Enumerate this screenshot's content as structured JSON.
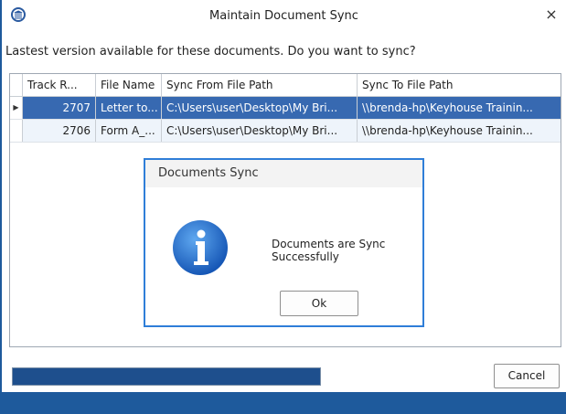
{
  "window": {
    "title": "Maintain Document Sync",
    "close_glyph": "×",
    "app_icon": "institution-icon"
  },
  "prompt": "Lastest version available for these documents. Do you want to sync?",
  "grid": {
    "columns": [
      "Track R...",
      "File Name",
      "Sync From File Path",
      "Sync To File Path"
    ],
    "rows": [
      {
        "indicator": "▶",
        "track": "2707",
        "file": "Letter to...",
        "from": "C:\\Users\\user\\Desktop\\My Bri...",
        "to": "\\\\brenda-hp\\Keyhouse Trainin..."
      },
      {
        "indicator": "",
        "track": "2706",
        "file": "Form A_...",
        "from": "C:\\Users\\user\\Desktop\\My Bri...",
        "to": "\\\\brenda-hp\\Keyhouse Trainin..."
      }
    ]
  },
  "modal": {
    "title": "Documents Sync",
    "message": "Documents are Sync Successfully",
    "ok_label": "Ok",
    "icon": "info-icon"
  },
  "progress": {
    "value": 1.0
  },
  "cancel_label": "Cancel",
  "colors": {
    "accent": "#2f7ed8",
    "selection": "#3769b1",
    "progress_fill": "#1e4f8d",
    "taskbar": "#1e5a9c"
  }
}
